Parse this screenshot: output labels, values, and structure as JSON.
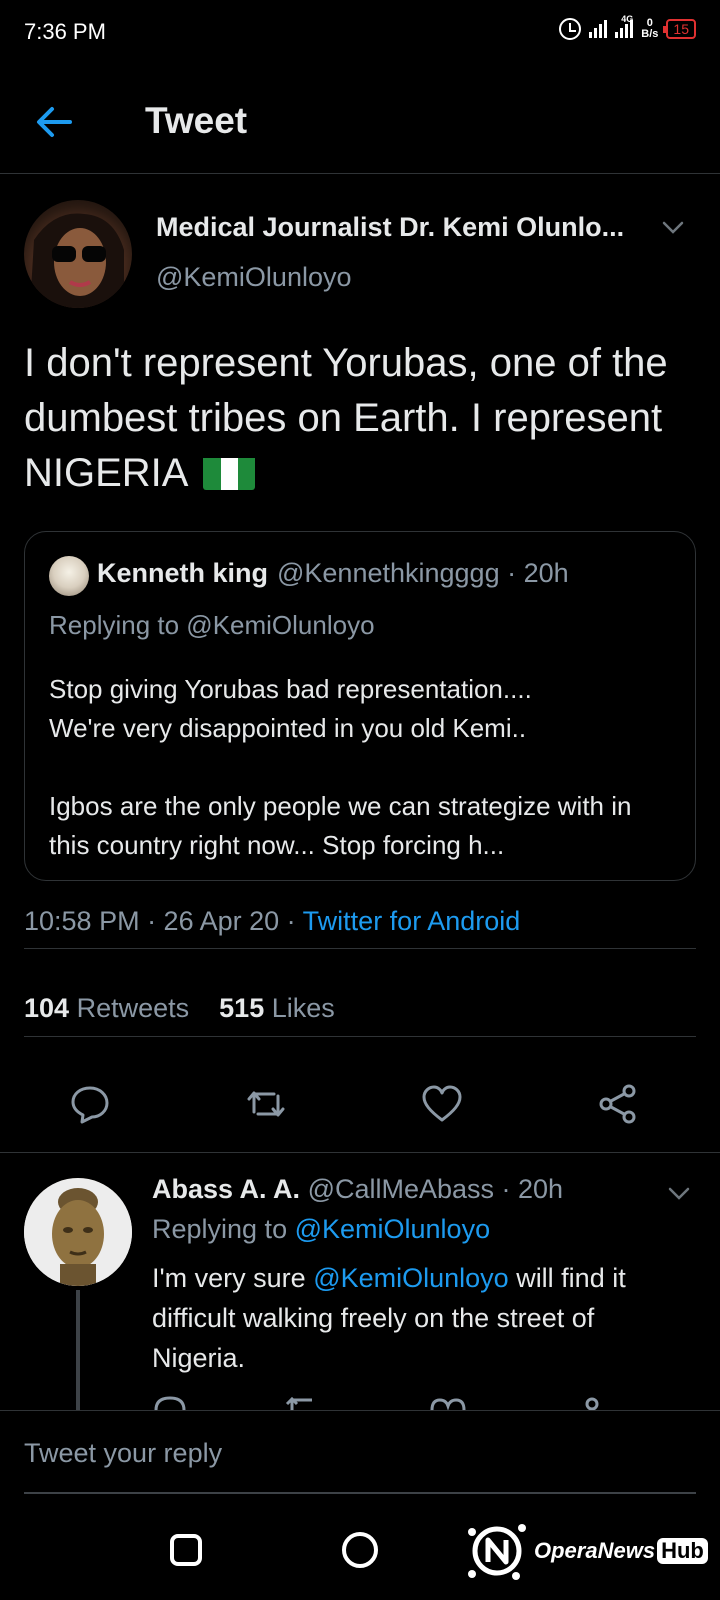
{
  "status_bar": {
    "time": "7:36 PM",
    "network_type": "4G",
    "net_speed_value": "0",
    "net_speed_unit": "B/s",
    "battery": "15",
    "battery_color": "#e03131"
  },
  "header": {
    "title": "Tweet",
    "back_icon": "arrow-left-icon",
    "accent": "#1d9bf0"
  },
  "tweet": {
    "author_name": "Medical Journalist Dr. Kemi Olunlo...",
    "author_handle": "@KemiOlunloyo",
    "text": "I don't represent Yorubas, one of the dumbest tribes on Earth. I represent NIGERIA",
    "emoji": "nigeria-flag",
    "quoted": {
      "name": "Kenneth king",
      "handle_time": "@Kennethkingggg · 20h",
      "replying_to": "Replying to @KemiOlunloyo",
      "text": "Stop giving Yorubas bad representation....\nWe're very disappointed in you old Kemi..\n\nIgbos are the only people we can strategize with in this country right now... Stop forcing h..."
    },
    "time": "10:58 PM · 26 Apr 20 · ",
    "source": "Twitter for Android",
    "retweets_count": "104",
    "retweets_label": "Retweets",
    "likes_count": "515",
    "likes_label": "Likes",
    "actions": [
      "reply-icon",
      "retweet-icon",
      "like-icon",
      "share-icon"
    ]
  },
  "reply": {
    "name": "Abass A. A.",
    "handle_time": "@CallMeAbass · 20h",
    "replying_prefix": "Replying to ",
    "replying_to": "@KemiOlunloyo",
    "text_before": "I'm very sure ",
    "mention": "@KemiOlunloyo",
    "text_after": " will find it difficult walking freely on the street of Nigeria."
  },
  "compose": {
    "placeholder": "Tweet your reply"
  },
  "nav": {
    "watermark_text": "OperaNews",
    "watermark_hub": "Hub"
  }
}
